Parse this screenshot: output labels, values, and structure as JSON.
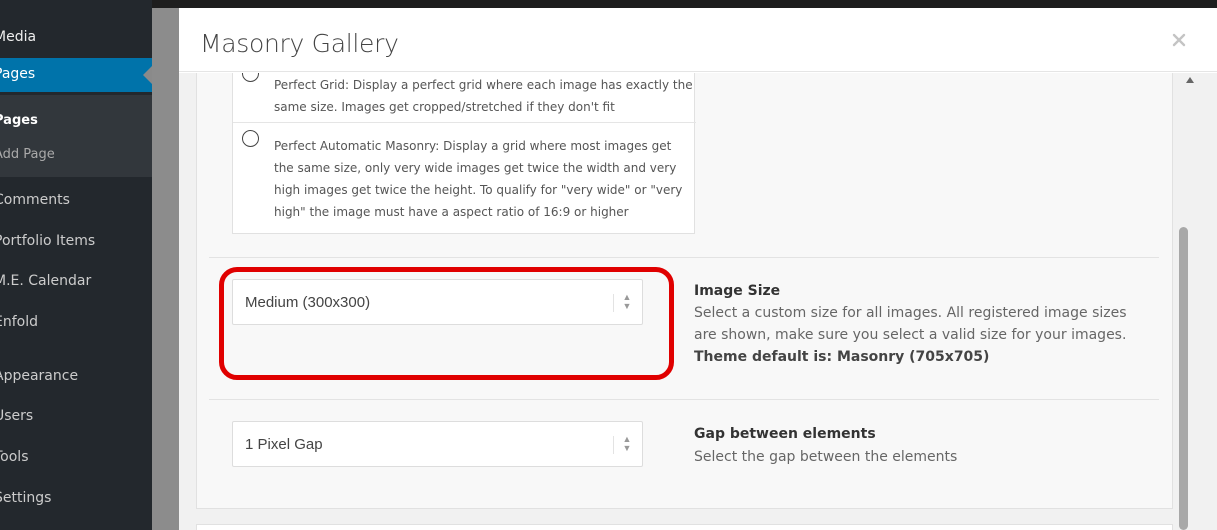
{
  "sidebar": {
    "items": [
      {
        "label": "Media"
      },
      {
        "label": "Pages"
      },
      {
        "label": "Pages"
      },
      {
        "label": "Add Page"
      },
      {
        "label": "Comments"
      },
      {
        "label": "Portfolio Items"
      },
      {
        "label": "M.E. Calendar"
      },
      {
        "label": "Enfold"
      },
      {
        "label": "Appearance"
      },
      {
        "label": "Users"
      },
      {
        "label": "Tools"
      },
      {
        "label": "Settings"
      }
    ]
  },
  "modal": {
    "title": "Masonry Gallery",
    "close_icon": "close-icon"
  },
  "layout_options": [
    {
      "text": "Perfect Grid: Display a perfect grid where each image has exactly the same size. Images get cropped/stretched if they don't fit"
    },
    {
      "text": "Perfect Automatic Masonry: Display a grid where most images get the same size, only very wide images get twice the width and very high images get twice the height. To qualify for \"very wide\" or \"very high\" the image must have a aspect ratio of 16:9 or higher"
    }
  ],
  "image_size": {
    "selected": "Medium (300x300)",
    "label": "Image Size",
    "description": "Select a custom size for all images. All registered image sizes are shown, make sure you select a valid size for your images.",
    "default_note": "Theme default is: Masonry (705x705)"
  },
  "gap": {
    "selected": "1 Pixel Gap",
    "label": "Gap between elements",
    "description": "Select the gap between the elements"
  },
  "colors": {
    "highlight": "#e00000",
    "sidebar_bg": "#23282d",
    "sidebar_current": "#0073aa"
  }
}
